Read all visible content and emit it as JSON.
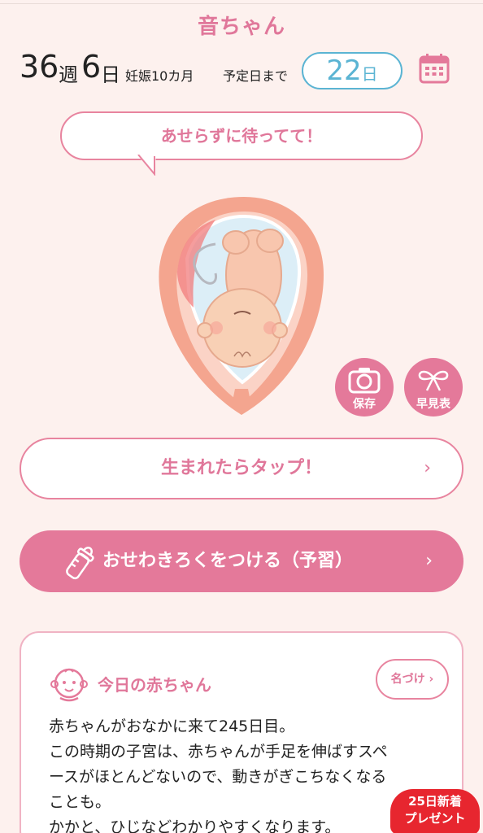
{
  "header": {
    "title": "音ちゃん"
  },
  "pregnancy": {
    "weeks": "36",
    "week_unit": "週",
    "days": "6",
    "day_unit": "日",
    "month_text": "妊娠10カ月",
    "due_label": "予定日まで",
    "due_days": "22",
    "due_unit": "日"
  },
  "bubble": {
    "message": "あせらずに待ってて！"
  },
  "actions": {
    "save_label": "保存",
    "list_label": "早見表",
    "tap_label": "生まれたらタップ！",
    "record_label": "おせわきろくをつける（予習）",
    "chevron": "›"
  },
  "today_card": {
    "title": "今日の赤ちゃん",
    "name_button": "名づけ ›",
    "lines": [
      "赤ちゃんがおなかに来て245日目。",
      "この時期の子宮は、赤ちゃんが手足を伸ばすスペ",
      "ースがほとんどないので、動きがぎこちなくなる",
      "ことも。",
      "かかと、ひじなどわかりやすくなります。"
    ]
  },
  "badge": {
    "line1": "25日新着",
    "line2": "プレゼント"
  },
  "colors": {
    "accent": "#e4799a",
    "due_blue": "#5bb4d3",
    "present_red": "#e7262f"
  }
}
